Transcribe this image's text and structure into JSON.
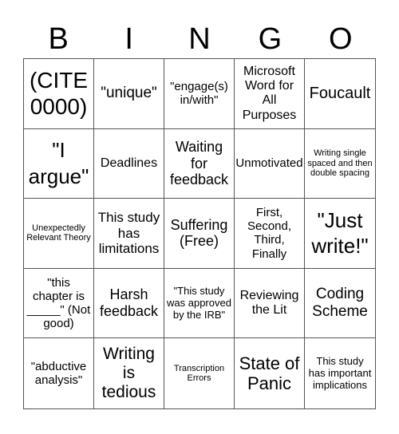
{
  "header": [
    "B",
    "I",
    "N",
    "G",
    "O"
  ],
  "cells": [
    "(CITE 0000)",
    "\"unique\"",
    "\"engage(s) in/with\"",
    "Microsoft Word for All Purposes",
    "Foucault",
    "\"I argue\"",
    "Deadlines",
    "Waiting for feedback",
    "Unmotivated",
    "Writing single spaced and then double spacing",
    "Unexpectedly Relevant Theory",
    "This study has limitations",
    "Suffering (Free)",
    "First, Second, Third, Finally",
    "\"Just write!\"",
    "\"this chapter is _____\" (Not good)",
    "Harsh feedback",
    "\"This study was approved by the IRB\"",
    "Reviewing the Lit",
    "Coding Scheme",
    "\"abductive analysis\"",
    "Writing is tedious",
    "Transcription Errors",
    "State of Panic",
    "This study has important implications"
  ]
}
